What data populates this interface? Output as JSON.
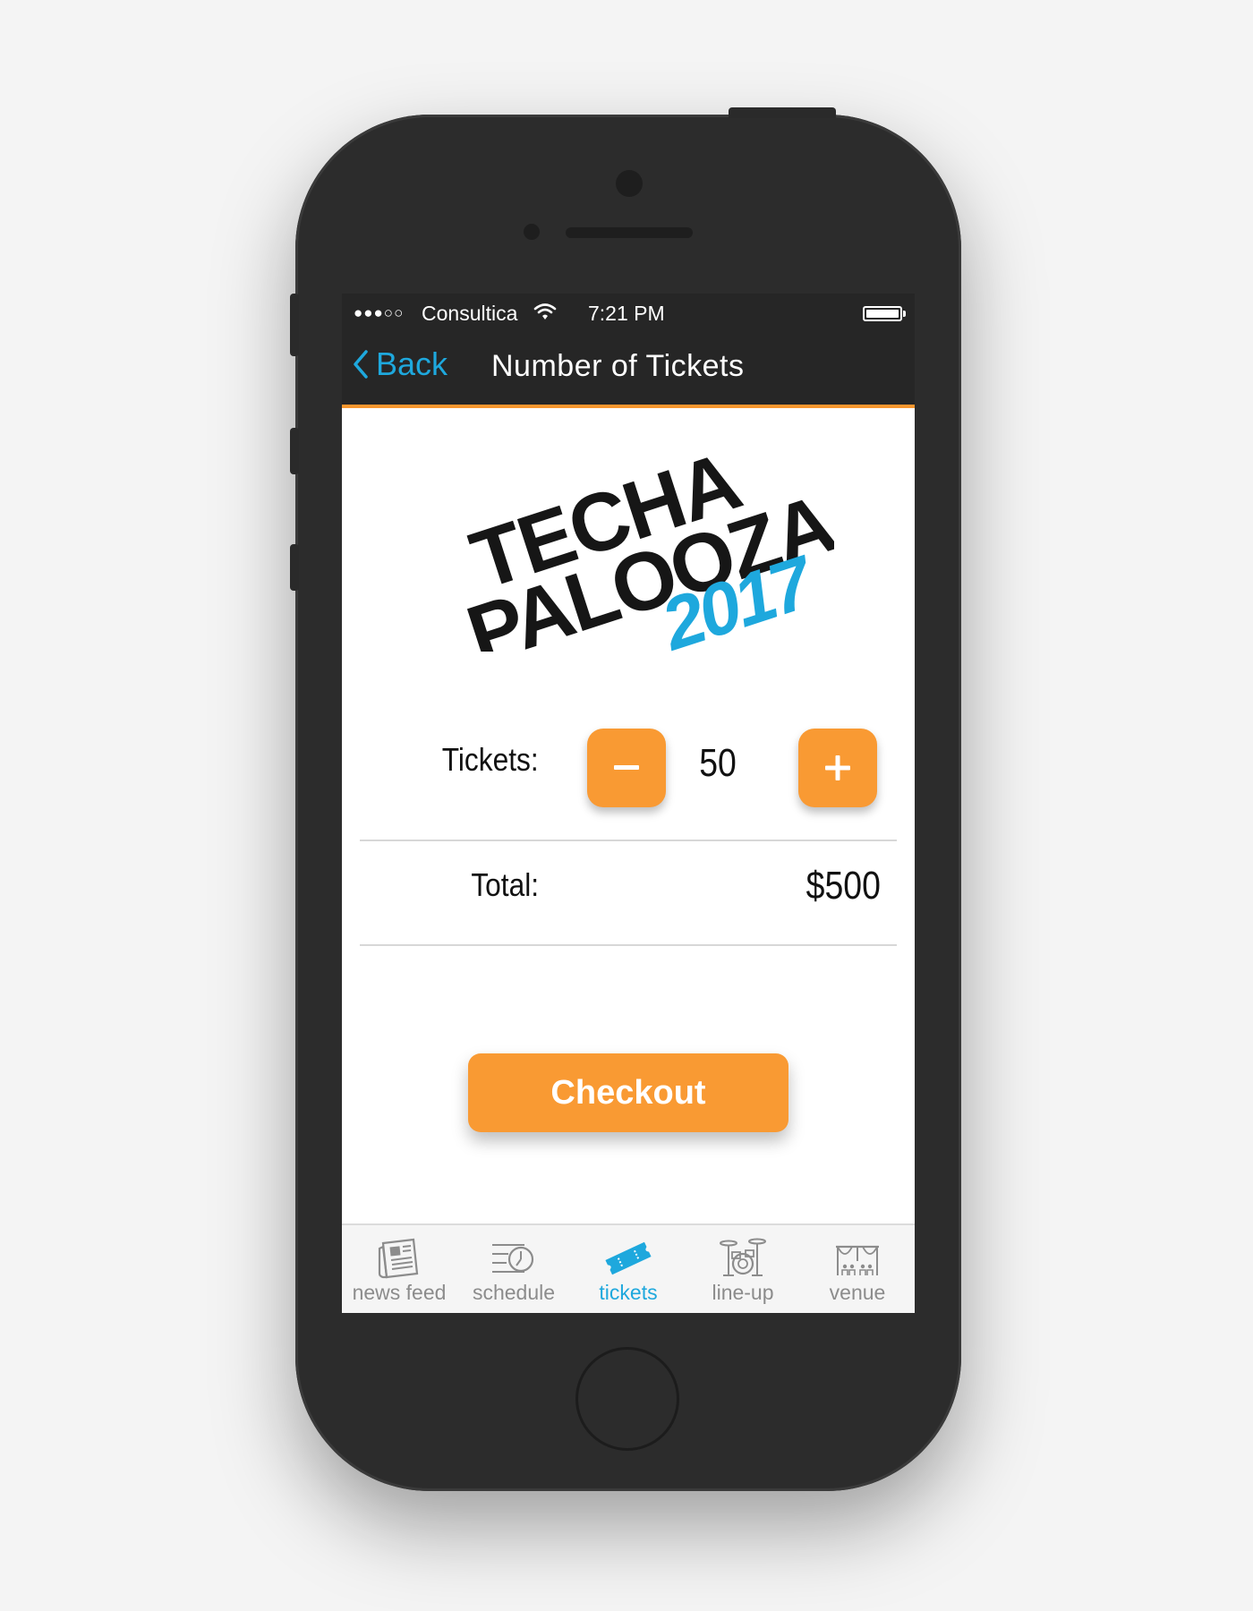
{
  "status_bar": {
    "signal": "●●●○○",
    "carrier": "Consultica",
    "time": "7:21 PM"
  },
  "nav": {
    "back_label": "Back",
    "title": "Number of Tickets"
  },
  "logo": {
    "line1": "TECHA",
    "line2": "PALOOZA",
    "year": "2017"
  },
  "tickets": {
    "label": "Tickets:",
    "quantity": "50",
    "decrement": "−",
    "increment": "+"
  },
  "total": {
    "label": "Total:",
    "value": "$500"
  },
  "checkout_label": "Checkout",
  "tabs": [
    {
      "label": "news feed",
      "icon": "newspaper-icon"
    },
    {
      "label": "schedule",
      "icon": "clock-icon"
    },
    {
      "label": "tickets",
      "icon": "ticket-icon",
      "active": true
    },
    {
      "label": "line-up",
      "icon": "drum-kit-icon"
    },
    {
      "label": "venue",
      "icon": "stage-icon"
    }
  ],
  "colors": {
    "accent": "#f99a33",
    "link": "#1ea8dd",
    "bar": "#262626",
    "tab_inactive": "#8c8c8c"
  }
}
